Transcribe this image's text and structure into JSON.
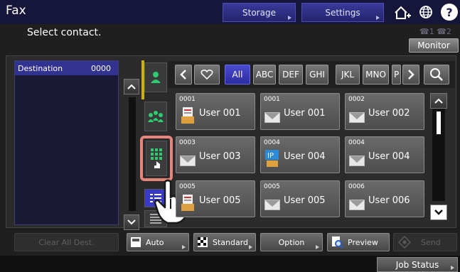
{
  "header": {
    "title": "Fax",
    "storage_label": "Storage",
    "settings_label": "Settings",
    "help_label": "?",
    "instruction": "Select contact.",
    "line_labels": "☎1 ☎2",
    "monitor_label": "Monitor"
  },
  "destination": {
    "header_label": "Destination",
    "count": "0000"
  },
  "index_tabs": {
    "all": "All",
    "abc": "ABC",
    "def": "DEF",
    "ghi": "GHI",
    "jkl": "JKL",
    "mno": "MNO",
    "partial": "P"
  },
  "contacts": [
    {
      "num": "0001",
      "name": "User 001",
      "type": "phone"
    },
    {
      "num": "0001",
      "name": "User 001",
      "type": "email"
    },
    {
      "num": "0002",
      "name": "User 002",
      "type": "email"
    },
    {
      "num": "0003",
      "name": "User 003",
      "type": "email"
    },
    {
      "num": "0004",
      "name": "User 004",
      "type": "ip"
    },
    {
      "num": "0004",
      "name": "User 004",
      "type": "email"
    },
    {
      "num": "0005",
      "name": "User 005",
      "type": "phone"
    },
    {
      "num": "0005",
      "name": "User 005",
      "type": "email"
    },
    {
      "num": "0006",
      "name": "User 006",
      "type": "email"
    }
  ],
  "bottom": {
    "clear_all": "Clear All Dest.",
    "auto": "Auto",
    "standard": "Standard",
    "option": "Option",
    "preview": "Preview",
    "send": "Send"
  },
  "status": {
    "job_status": "Job Status"
  },
  "colors": {
    "accent_blue": "#3434a0",
    "highlight": "#e8857a",
    "selected_tab": "#3a3ac8",
    "active_indicator": "#c8b400"
  }
}
